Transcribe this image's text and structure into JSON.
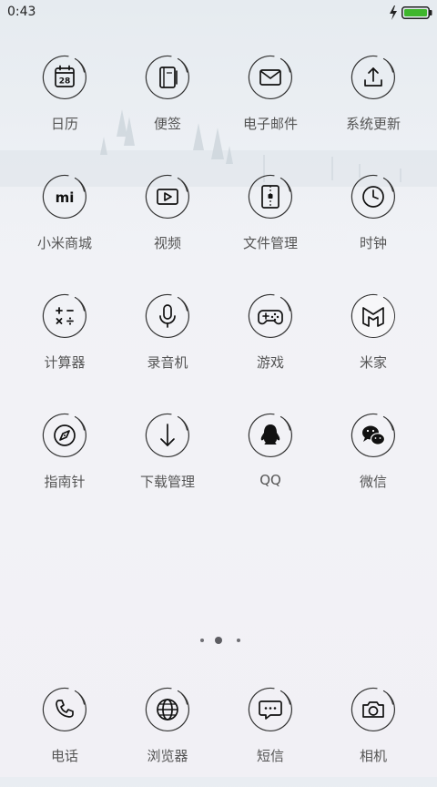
{
  "status_bar": {
    "time": "0:43",
    "icons": [
      "charging-bolt-icon",
      "battery-icon"
    ],
    "battery_color": "#3fb62d"
  },
  "apps": [
    {
      "label": "日历",
      "icon": "calendar-icon",
      "icon_text": "28"
    },
    {
      "label": "便签",
      "icon": "notes-icon"
    },
    {
      "label": "电子邮件",
      "icon": "mail-icon"
    },
    {
      "label": "系统更新",
      "icon": "upload-icon"
    },
    {
      "label": "小米商城",
      "icon": "mi-store-icon",
      "icon_text": "mi"
    },
    {
      "label": "视频",
      "icon": "video-icon"
    },
    {
      "label": "文件管理",
      "icon": "file-manager-icon"
    },
    {
      "label": "时钟",
      "icon": "clock-icon"
    },
    {
      "label": "计算器",
      "icon": "calculator-icon"
    },
    {
      "label": "录音机",
      "icon": "microphone-icon"
    },
    {
      "label": "游戏",
      "icon": "gamepad-icon"
    },
    {
      "label": "米家",
      "icon": "mijia-icon"
    },
    {
      "label": "指南针",
      "icon": "compass-icon"
    },
    {
      "label": "下载管理",
      "icon": "download-icon"
    },
    {
      "label": "QQ",
      "icon": "qq-penguin-icon"
    },
    {
      "label": "微信",
      "icon": "wechat-icon"
    }
  ],
  "page_indicator": {
    "count": 3,
    "active_index": 1
  },
  "dock": [
    {
      "label": "电话",
      "icon": "phone-icon"
    },
    {
      "label": "浏览器",
      "icon": "globe-icon"
    },
    {
      "label": "短信",
      "icon": "message-icon"
    },
    {
      "label": "相机",
      "icon": "camera-icon"
    }
  ]
}
